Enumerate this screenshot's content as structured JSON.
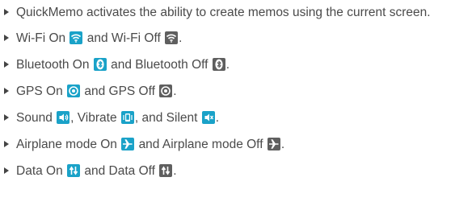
{
  "items": [
    {
      "text": "QuickMemo activates the ability to create memos using the current screen."
    },
    {
      "parts": [
        "Wi-Fi On",
        "and Wi-Fi Off",
        "."
      ]
    },
    {
      "parts": [
        "Bluetooth On",
        "and Bluetooth Off",
        "."
      ]
    },
    {
      "parts": [
        "GPS On",
        "and GPS Off",
        "."
      ]
    },
    {
      "parts": [
        "Sound",
        ", Vibrate",
        ", and Silent",
        "."
      ]
    },
    {
      "parts": [
        "Airplane mode On",
        "and Airplane mode Off",
        "."
      ]
    },
    {
      "parts": [
        "Data On",
        "and Data Off",
        "."
      ]
    }
  ],
  "icons": {
    "wifi_on": "wifi-on-icon",
    "wifi_off": "wifi-off-icon",
    "bluetooth_on": "bluetooth-on-icon",
    "bluetooth_off": "bluetooth-off-icon",
    "gps_on": "gps-on-icon",
    "gps_off": "gps-off-icon",
    "sound": "sound-icon",
    "vibrate": "vibrate-icon",
    "silent": "silent-icon",
    "airplane_on": "airplane-on-icon",
    "airplane_off": "airplane-off-icon",
    "data_on": "data-on-icon",
    "data_off": "data-off-icon"
  },
  "colors": {
    "text": "#4a4a4a",
    "icon_on_bg": "#1aa2c8",
    "icon_off_bg": "#5f5f5f",
    "icon_glyph": "#ffffff"
  }
}
